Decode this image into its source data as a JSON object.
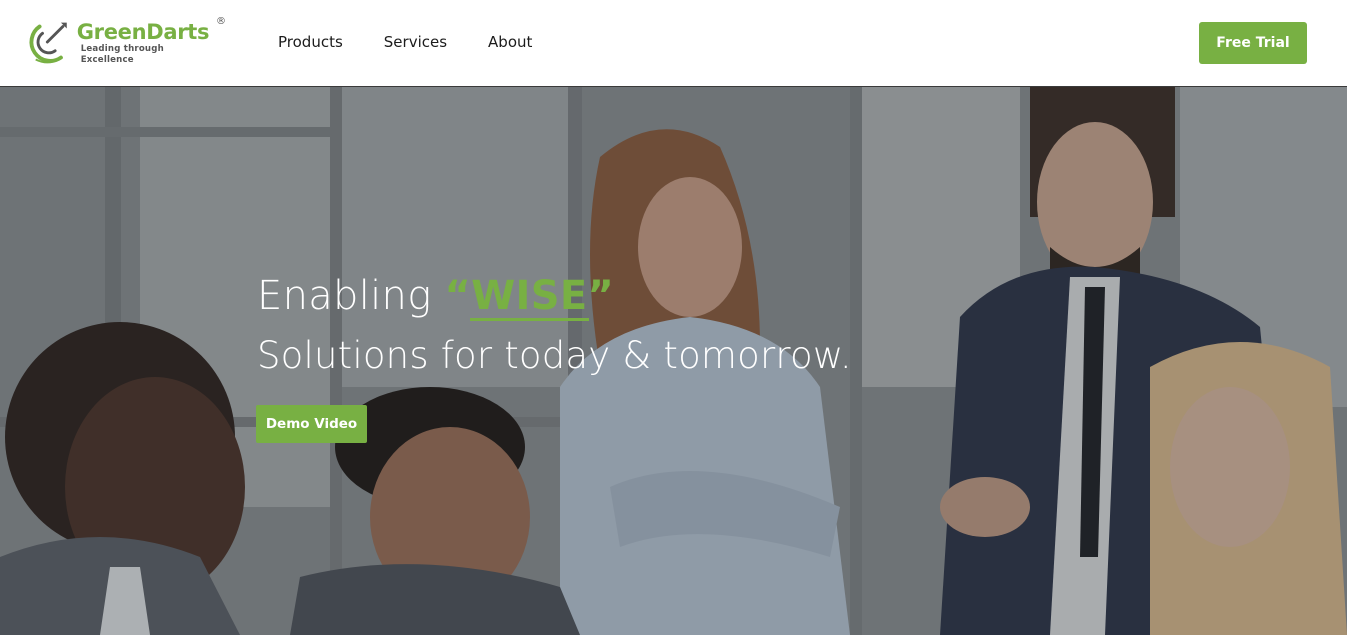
{
  "brand": {
    "name_part1": "Green",
    "name_part2": "Darts",
    "registered": "®",
    "tagline": "Leading through Excellence",
    "logo_icon": "dart-target-icon",
    "accent_color": "#78b043"
  },
  "nav": {
    "items": [
      {
        "label": "Products"
      },
      {
        "label": "Services"
      },
      {
        "label": "About"
      }
    ]
  },
  "header": {
    "cta_label": "Free Trial"
  },
  "hero": {
    "line1_prefix": "Enabling ",
    "line1_highlight": "“WISE”",
    "line2": "Solutions for today & tomorrow.",
    "button_label": "Demo Video",
    "background_image": "office-meeting-photo"
  }
}
